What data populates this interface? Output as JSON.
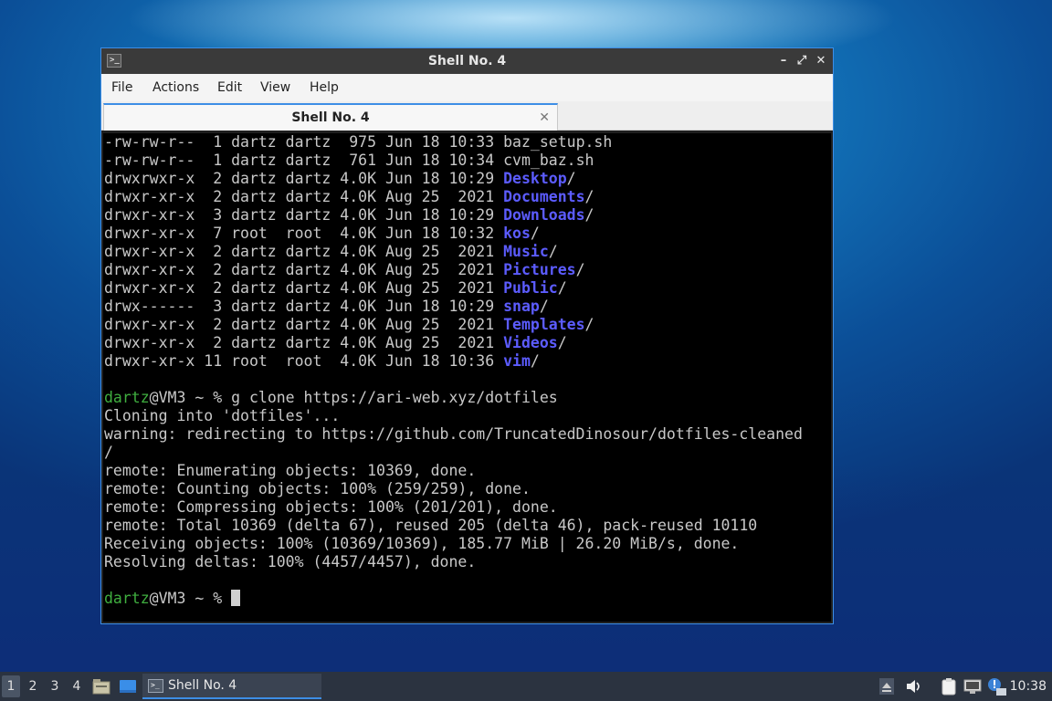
{
  "window": {
    "title": "Shell No. 4",
    "controls": {
      "minimize": "–",
      "maximize": "⤢",
      "close": "✕"
    }
  },
  "menubar": {
    "items": [
      "File",
      "Actions",
      "Edit",
      "View",
      "Help"
    ]
  },
  "tab": {
    "label": "Shell No. 4",
    "close": "✕"
  },
  "terminal": {
    "listing": [
      {
        "perms": "-rw-rw-r--",
        "links": " 1",
        "owner": "dartz",
        "group": "dartz",
        "size": " 975",
        "month": "Jun",
        "day": "18",
        "time": "10:33",
        "name": "baz_setup.sh",
        "is_dir": false
      },
      {
        "perms": "-rw-rw-r--",
        "links": " 1",
        "owner": "dartz",
        "group": "dartz",
        "size": " 761",
        "month": "Jun",
        "day": "18",
        "time": "10:34",
        "name": "cvm_baz.sh",
        "is_dir": false
      },
      {
        "perms": "drwxrwxr-x",
        "links": " 2",
        "owner": "dartz",
        "group": "dartz",
        "size": "4.0K",
        "month": "Jun",
        "day": "18",
        "time": "10:29",
        "name": "Desktop",
        "is_dir": true
      },
      {
        "perms": "drwxr-xr-x",
        "links": " 2",
        "owner": "dartz",
        "group": "dartz",
        "size": "4.0K",
        "month": "Aug",
        "day": "25",
        "time": " 2021",
        "name": "Documents",
        "is_dir": true
      },
      {
        "perms": "drwxr-xr-x",
        "links": " 3",
        "owner": "dartz",
        "group": "dartz",
        "size": "4.0K",
        "month": "Jun",
        "day": "18",
        "time": "10:29",
        "name": "Downloads",
        "is_dir": true
      },
      {
        "perms": "drwxr-xr-x",
        "links": " 7",
        "owner": "root ",
        "group": "root ",
        "size": "4.0K",
        "month": "Jun",
        "day": "18",
        "time": "10:32",
        "name": "kos",
        "is_dir": true
      },
      {
        "perms": "drwxr-xr-x",
        "links": " 2",
        "owner": "dartz",
        "group": "dartz",
        "size": "4.0K",
        "month": "Aug",
        "day": "25",
        "time": " 2021",
        "name": "Music",
        "is_dir": true
      },
      {
        "perms": "drwxr-xr-x",
        "links": " 2",
        "owner": "dartz",
        "group": "dartz",
        "size": "4.0K",
        "month": "Aug",
        "day": "25",
        "time": " 2021",
        "name": "Pictures",
        "is_dir": true
      },
      {
        "perms": "drwxr-xr-x",
        "links": " 2",
        "owner": "dartz",
        "group": "dartz",
        "size": "4.0K",
        "month": "Aug",
        "day": "25",
        "time": " 2021",
        "name": "Public",
        "is_dir": true
      },
      {
        "perms": "drwx------",
        "links": " 3",
        "owner": "dartz",
        "group": "dartz",
        "size": "4.0K",
        "month": "Jun",
        "day": "18",
        "time": "10:29",
        "name": "snap",
        "is_dir": true
      },
      {
        "perms": "drwxr-xr-x",
        "links": " 2",
        "owner": "dartz",
        "group": "dartz",
        "size": "4.0K",
        "month": "Aug",
        "day": "25",
        "time": " 2021",
        "name": "Templates",
        "is_dir": true
      },
      {
        "perms": "drwxr-xr-x",
        "links": " 2",
        "owner": "dartz",
        "group": "dartz",
        "size": "4.0K",
        "month": "Aug",
        "day": "25",
        "time": " 2021",
        "name": "Videos",
        "is_dir": true
      },
      {
        "perms": "drwxr-xr-x",
        "links": "11",
        "owner": "root ",
        "group": "root ",
        "size": "4.0K",
        "month": "Jun",
        "day": "18",
        "time": "10:36",
        "name": "vim",
        "is_dir": true
      }
    ],
    "prompt_user": "dartz",
    "prompt_rest": "@VM3 ~ % ",
    "command": "g clone https://ari-web.xyz/dotfiles",
    "output": [
      "Cloning into 'dotfiles'...",
      "warning: redirecting to https://github.com/TruncatedDinosour/dotfiles-cleaned",
      "/",
      "remote: Enumerating objects: 10369, done.",
      "remote: Counting objects: 100% (259/259), done.",
      "remote: Compressing objects: 100% (201/201), done.",
      "remote: Total 10369 (delta 67), reused 205 (delta 46), pack-reused 10110",
      "Receiving objects: 100% (10369/10369), 185.77 MiB | 26.20 MiB/s, done.",
      "Resolving deltas: 100% (4457/4457), done."
    ]
  },
  "taskbar": {
    "workspaces": [
      "1",
      "2",
      "3",
      "4"
    ],
    "active_workspace": "1",
    "task_label": "Shell No. 4",
    "clock": "10:38",
    "icons": [
      "file-manager-icon",
      "show-desktop-icon",
      "up-arrow-icon",
      "volume-icon",
      "clipboard-icon",
      "network-icon",
      "update-notifier-icon"
    ]
  },
  "colors": {
    "directory": "#5c5cff",
    "prompt_user": "#3fae3f",
    "terminal_text": "#c8c8c8",
    "window_accent": "#3d8ee6",
    "taskbar_bg": "#2b3340"
  }
}
